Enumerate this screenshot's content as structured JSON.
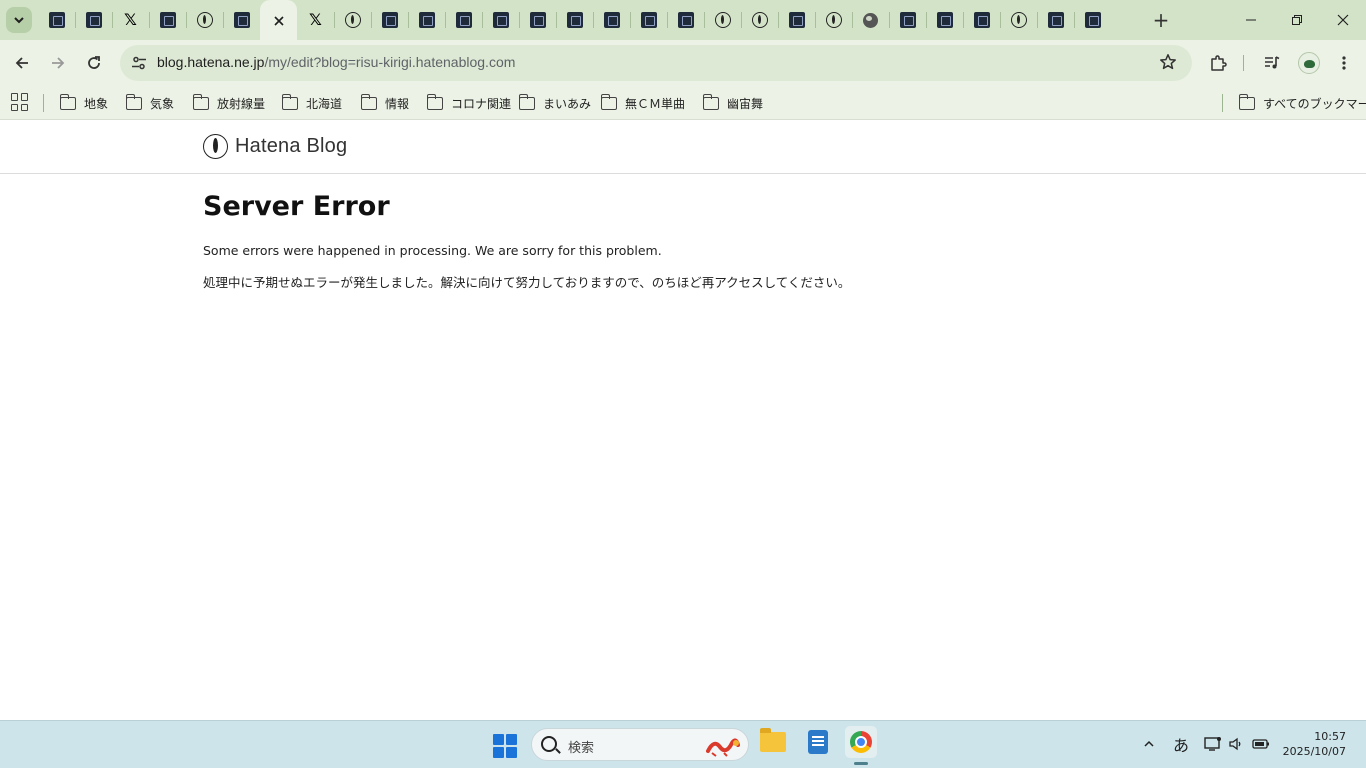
{
  "browser": {
    "tabs": [
      {
        "favicon": "hatena-dark-favicon"
      },
      {
        "favicon": "hatena-dark-favicon"
      },
      {
        "favicon": "x-favicon"
      },
      {
        "favicon": "hatena-dark-favicon"
      },
      {
        "favicon": "hatena-logo-favicon"
      },
      {
        "favicon": "hatena-dark-favicon"
      },
      {
        "favicon": "close-icon",
        "active": true
      },
      {
        "favicon": "x-favicon"
      },
      {
        "favicon": "hatena-logo-favicon"
      },
      {
        "favicon": "hatena-dark-favicon"
      },
      {
        "favicon": "hatena-dark-favicon"
      },
      {
        "favicon": "hatena-dark-favicon"
      },
      {
        "favicon": "hatena-dark-favicon"
      },
      {
        "favicon": "hatena-dark-favicon"
      },
      {
        "favicon": "hatena-dark-favicon"
      },
      {
        "favicon": "hatena-dark-favicon"
      },
      {
        "favicon": "hatena-dark-favicon"
      },
      {
        "favicon": "hatena-dark-favicon"
      },
      {
        "favicon": "hatena-logo-favicon"
      },
      {
        "favicon": "hatena-logo-favicon"
      },
      {
        "favicon": "hatena-dark-favicon"
      },
      {
        "favicon": "hatena-logo-favicon"
      },
      {
        "favicon": "globe-favicon"
      },
      {
        "favicon": "hatena-dark-favicon"
      },
      {
        "favicon": "hatena-dark-favicon"
      },
      {
        "favicon": "hatena-dark-favicon"
      },
      {
        "favicon": "hatena-logo-favicon"
      },
      {
        "favicon": "hatena-dark-favicon"
      },
      {
        "favicon": "hatena-dark-favicon"
      }
    ],
    "url_host": "blog.hatena.ne.jp",
    "url_path": "/my/edit?blog=risu-kirigi.hatenablog.com",
    "bookmarks": [
      "地象",
      "気象",
      "放射線量",
      "北海道",
      "情報",
      "コロナ関連",
      "まいあみ",
      "無ＣＭ単曲",
      "幽宙舞"
    ],
    "all_bookmarks_label": "すべてのブックマーク",
    "accent_color": "#d3e3c8"
  },
  "page": {
    "logo_text": "Hatena Blog",
    "error_title": "Server Error",
    "message_en": "Some errors were happened in processing. We are sorry for this problem.",
    "message_ja": "処理中に予期せぬエラーが発生しました。解決に向けて努力しておりますので、のちほど再アクセスしてください。"
  },
  "taskbar": {
    "search_placeholder": "検索",
    "ime_indicator": "あ",
    "time": "10:57",
    "date": "2025/10/07"
  }
}
